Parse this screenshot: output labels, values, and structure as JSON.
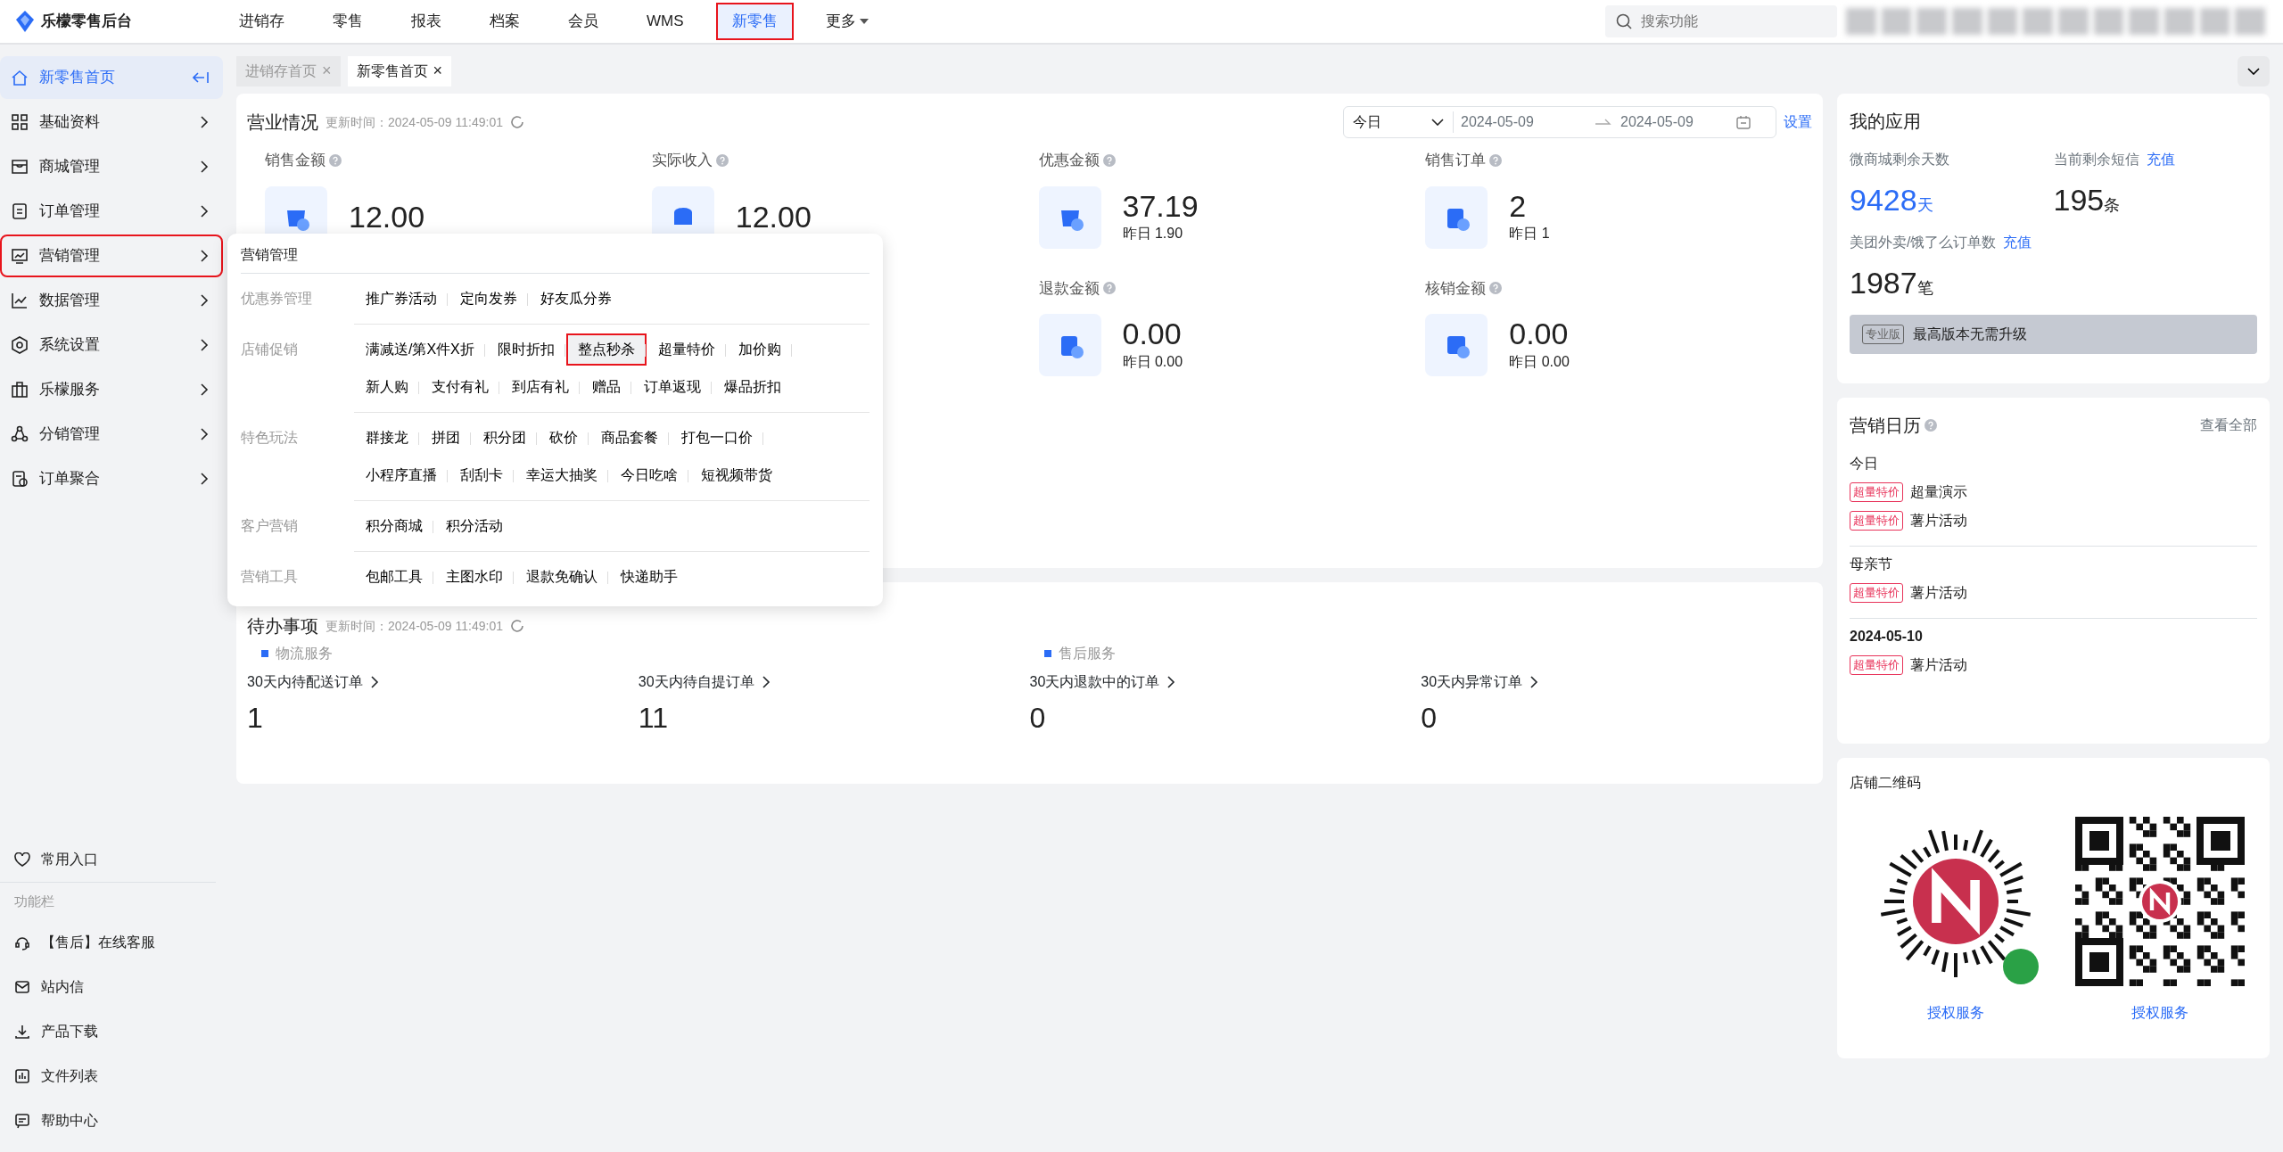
{
  "app": {
    "title": "乐檬零售后台"
  },
  "top_nav": [
    {
      "label": "进销存",
      "selected": false,
      "outlined": false,
      "kind": "link"
    },
    {
      "label": "零售",
      "selected": false,
      "outlined": false,
      "kind": "link"
    },
    {
      "label": "报表",
      "selected": false,
      "outlined": false,
      "kind": "link"
    },
    {
      "label": "档案",
      "selected": false,
      "outlined": false,
      "kind": "link"
    },
    {
      "label": "会员",
      "selected": false,
      "outlined": false,
      "kind": "link"
    },
    {
      "label": "WMS",
      "selected": false,
      "outlined": false,
      "kind": "link"
    },
    {
      "label": "新零售",
      "selected": true,
      "outlined": true,
      "kind": "link"
    },
    {
      "label": "更多",
      "selected": false,
      "outlined": false,
      "kind": "dropdown"
    }
  ],
  "search": {
    "placeholder": "搜索功能"
  },
  "sidebar": {
    "items": [
      {
        "label": "新零售首页",
        "selected": true,
        "outlined": false
      },
      {
        "label": "基础资料",
        "selected": false,
        "outlined": false
      },
      {
        "label": "商城管理",
        "selected": false,
        "outlined": false
      },
      {
        "label": "订单管理",
        "selected": false,
        "outlined": false
      },
      {
        "label": "营销管理",
        "selected": false,
        "outlined": true
      },
      {
        "label": "数据管理",
        "selected": false,
        "outlined": false
      },
      {
        "label": "系统设置",
        "selected": false,
        "outlined": false
      },
      {
        "label": "乐檬服务",
        "selected": false,
        "outlined": false
      },
      {
        "label": "分销管理",
        "selected": false,
        "outlined": false
      },
      {
        "label": "订单聚合",
        "selected": false,
        "outlined": false
      }
    ],
    "favorites": "常用入口",
    "section_label": "功能栏",
    "footer_items": [
      "【售后】在线客服",
      "站内信",
      "产品下载",
      "文件列表",
      "帮助中心"
    ]
  },
  "page_tabs": [
    {
      "label": "进销存首页",
      "close": "×",
      "selected": false
    },
    {
      "label": "新零售首页",
      "close": "×",
      "selected": true
    }
  ],
  "business": {
    "title": "营业情况",
    "updated": "更新时间：2024-05-09 11:49:01",
    "range": {
      "period": "今日",
      "start": "2024-05-09",
      "end": "2024-05-09"
    },
    "settings": "设置",
    "stats": [
      {
        "label": "销售金额",
        "value": "12.00"
      },
      {
        "label": "实际收入",
        "value": "12.00"
      },
      {
        "label": "优惠金额",
        "value": "37.19",
        "yesterday": "昨日 1.90"
      },
      {
        "label": "销售订单",
        "value": "2",
        "yesterday": "昨日 1"
      },
      {
        "label": "退款金额",
        "value": "0.00",
        "yesterday": "昨日 0.00"
      },
      {
        "label": "核销金额",
        "value": "0.00",
        "yesterday": "昨日 0.00"
      }
    ]
  },
  "pending": {
    "title": "待办事项",
    "updated": "更新时间：2024-05-09 11:49:01",
    "groups": [
      {
        "label": "物流服务",
        "items": [
          {
            "label": "30天内待配送订单",
            "count": "1"
          },
          {
            "label": "30天内待自提订单",
            "count": "11"
          }
        ]
      },
      {
        "label": "售后服务",
        "items": [
          {
            "label": "30天内退款中的订单",
            "count": "0"
          },
          {
            "label": "30天内异常订单",
            "count": "0"
          }
        ]
      }
    ]
  },
  "popup": {
    "title": "营销管理",
    "groups": [
      {
        "label": "优惠券管理",
        "items": [
          {
            "label": "推广券活动",
            "outlined": false
          },
          {
            "label": "定向发券",
            "outlined": false
          },
          {
            "label": "好友瓜分券",
            "outlined": false
          }
        ]
      },
      {
        "label": "店铺促销",
        "items": [
          {
            "label": "满减送/第X件X折",
            "outlined": false
          },
          {
            "label": "限时折扣",
            "outlined": false
          },
          {
            "label": "整点秒杀",
            "outlined": true
          },
          {
            "label": "超量特价",
            "outlined": false
          },
          {
            "label": "加价购",
            "outlined": false
          },
          {
            "label": "新人购",
            "outlined": false
          },
          {
            "label": "支付有礼",
            "outlined": false
          },
          {
            "label": "到店有礼",
            "outlined": false
          },
          {
            "label": "赠品",
            "outlined": false
          },
          {
            "label": "订单返现",
            "outlined": false
          },
          {
            "label": "爆品折扣",
            "outlined": false
          }
        ]
      },
      {
        "label": "特色玩法",
        "items": [
          {
            "label": "群接龙",
            "outlined": false
          },
          {
            "label": "拼团",
            "outlined": false
          },
          {
            "label": "积分团",
            "outlined": false
          },
          {
            "label": "砍价",
            "outlined": false
          },
          {
            "label": "商品套餐",
            "outlined": false
          },
          {
            "label": "打包一口价",
            "outlined": false
          },
          {
            "label": "小程序直播",
            "outlined": false
          },
          {
            "label": "刮刮卡",
            "outlined": false
          },
          {
            "label": "幸运大抽奖",
            "outlined": false
          },
          {
            "label": "今日吃啥",
            "outlined": false
          },
          {
            "label": "短视频带货",
            "outlined": false
          }
        ]
      },
      {
        "label": "客户营销",
        "items": [
          {
            "label": "积分商城",
            "outlined": false
          },
          {
            "label": "积分活动",
            "outlined": false
          }
        ]
      },
      {
        "label": "营销工具",
        "items": [
          {
            "label": "包邮工具",
            "outlined": false
          },
          {
            "label": "主图水印",
            "outlined": false
          },
          {
            "label": "退款免确认",
            "outlined": false
          },
          {
            "label": "快递助手",
            "outlined": false
          }
        ]
      }
    ]
  },
  "my_apps": {
    "title": "我的应用",
    "metrics": [
      {
        "label": "微商城剩余天数",
        "value": "9428",
        "unit": "天",
        "accent": true
      },
      {
        "label": "当前剩余短信",
        "action": "充值",
        "value": "195",
        "unit": "条",
        "accent": false
      },
      {
        "label": "美团外卖/饿了么订单数",
        "action": "充值",
        "value": "1987",
        "unit": "笔",
        "accent": false
      }
    ],
    "plan": {
      "badge": "专业版",
      "text": "最高版本无需升级"
    }
  },
  "calendar": {
    "title": "营销日历",
    "view_all": "查看全部",
    "days": [
      {
        "label": "今日",
        "kind": "name",
        "events": [
          {
            "tag": "超量特价",
            "name": "超量演示"
          },
          {
            "tag": "超量特价",
            "name": "薯片活动"
          }
        ]
      },
      {
        "label": "母亲节",
        "kind": "name",
        "events": [
          {
            "tag": "超量特价",
            "name": "薯片活动"
          }
        ]
      },
      {
        "label": "2024-05-10",
        "kind": "date",
        "events": [
          {
            "tag": "超量特价",
            "name": "薯片活动"
          }
        ]
      }
    ]
  },
  "qr": {
    "title": "店铺二维码",
    "codes": [
      {
        "kind": "mini",
        "link": "授权服务"
      },
      {
        "kind": "qr",
        "link": "授权服务"
      }
    ]
  }
}
